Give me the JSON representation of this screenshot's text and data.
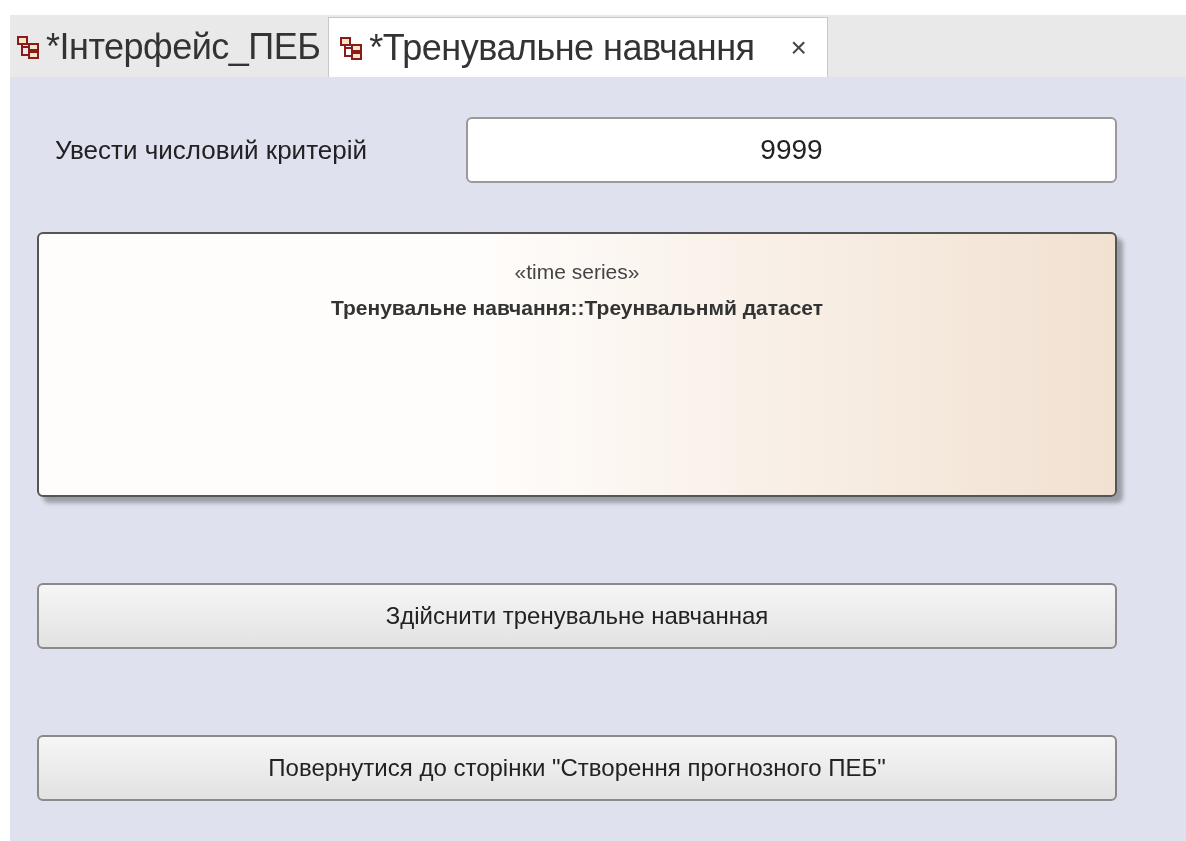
{
  "tabs": [
    {
      "label": "*Інтерфейс_ПЕБ",
      "selected": false
    },
    {
      "label": "*Тренувальне навчання",
      "selected": true,
      "close": "×"
    }
  ],
  "criterion": {
    "label": "Увести числовий критерій",
    "value": "9999"
  },
  "element": {
    "stereotype": "«time series»",
    "name": "Тренувальне навчання::Треунвальнмй датасет"
  },
  "buttons": [
    "Здійснити тренувальне навчанная",
    "Повернутися до сторінки \"Створення прогнозного ПЕБ\""
  ]
}
